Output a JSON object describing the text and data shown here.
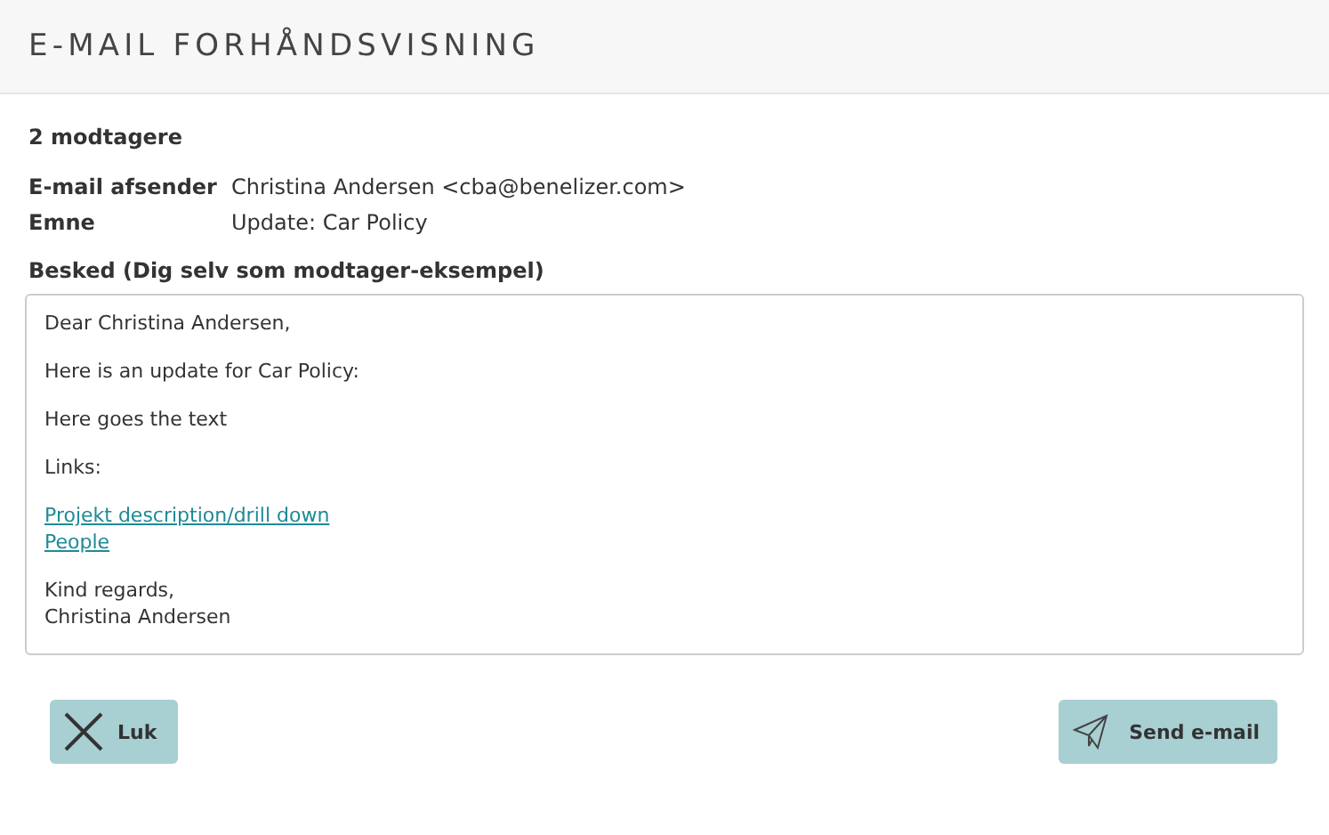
{
  "window": {
    "title": "E-MAIL FORHÅNDSVISNING"
  },
  "recipients": "2 modtagere",
  "fields": [
    {
      "label": "E-mail afsender",
      "value": "Christina Andersen <cba@benelizer.com>"
    },
    {
      "label": "Emne",
      "value": "Update: Car Policy"
    }
  ],
  "message": {
    "label": "Besked (Dig selv som modtager-eksempel)",
    "paragraphs": [
      [
        {
          "kind": "text",
          "text": "Dear Christina Andersen,"
        }
      ],
      [
        {
          "kind": "text",
          "text": "Here is an update for Car Policy:"
        }
      ],
      [
        {
          "kind": "text",
          "text": "Here goes the text"
        }
      ],
      [
        {
          "kind": "text",
          "text": "Links:"
        }
      ],
      [
        {
          "kind": "link",
          "text": "Projekt description/drill down"
        },
        {
          "kind": "link",
          "text": "People"
        }
      ],
      [
        {
          "kind": "text",
          "text": "Kind regards,"
        },
        {
          "kind": "text",
          "text": "Christina Andersen"
        }
      ]
    ]
  },
  "buttons": [
    {
      "kind": "close",
      "label": "Luk"
    },
    {
      "kind": "send",
      "label": "Send e-mail"
    }
  ]
}
